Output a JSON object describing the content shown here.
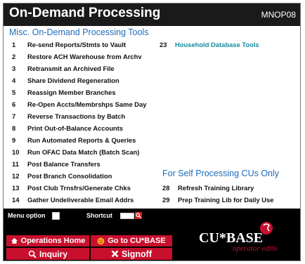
{
  "header": {
    "title": "On-Demand Processing",
    "screen_id": "MNOP08"
  },
  "section_misc": "Misc. On-Demand Processing Tools",
  "left_items": [
    {
      "num": "1",
      "label": "Re-send Reports/Stmts to Vault"
    },
    {
      "num": "2",
      "label": "Restore ACH Warehouse from Archv"
    },
    {
      "num": "3",
      "label": "Retransmit an Archived File"
    },
    {
      "num": "4",
      "label": "Share Dividend Regeneration"
    },
    {
      "num": "5",
      "label": "Reassign Member Branches"
    },
    {
      "num": "6",
      "label": "Re-Open Accts/Membrshps Same Day"
    },
    {
      "num": "7",
      "label": "Reverse Transactions by Batch"
    },
    {
      "num": "8",
      "label": "Print Out-of-Balance Accounts"
    },
    {
      "num": "9",
      "label": "Run Automated Reports & Queries"
    },
    {
      "num": "10",
      "label": "Run OFAC Data Match (Batch Scan)"
    },
    {
      "num": "11",
      "label": "Post Balance Transfers"
    },
    {
      "num": "12",
      "label": "Post Branch Consolidation"
    },
    {
      "num": "13",
      "label": "Post Club Trnsfrs/Generate Chks"
    },
    {
      "num": "14",
      "label": "Gather Undeliverable Email Addrs"
    }
  ],
  "right_top_item": {
    "num": "23",
    "label": "Household Database Tools"
  },
  "section_self": "For Self Processing CUs Only",
  "right_items": [
    {
      "num": "28",
      "label": "Refresh Training Library"
    },
    {
      "num": "29",
      "label": "Prep Training Lib for Daily Use"
    }
  ],
  "footer": {
    "menu_option_label": "Menu option",
    "shortcut_label": "Shortcut",
    "operations_home": "Operations Home",
    "go_to_cubase": "Go to CU*BASE",
    "inquiry": "Inquiry",
    "signoff": "Signoff"
  },
  "logo": {
    "brand": "CU*BASE",
    "tagline": "operator edition"
  },
  "colors": {
    "title_bar": "#1a1a1a",
    "heading_blue": "#1e6bb8",
    "teal_item": "#1a8a9e",
    "button_red": "#c8102e"
  }
}
